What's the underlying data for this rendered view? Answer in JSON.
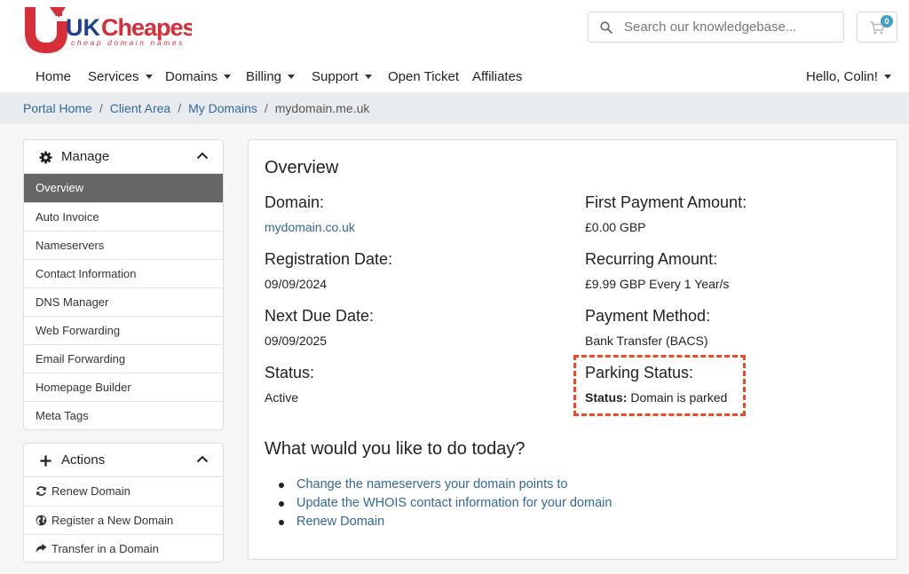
{
  "brand": {
    "name_uk": "UK",
    "name_rest": "Cheapest",
    "tagline": "cheap domain names",
    "color_blue": "#1c3f8e",
    "color_red": "#d62f3a"
  },
  "search": {
    "placeholder": "Search our knowledgebase..."
  },
  "cart": {
    "count": "0"
  },
  "nav": {
    "items": [
      {
        "label": "Home",
        "dropdown": false
      },
      {
        "label": "Services",
        "dropdown": true
      },
      {
        "label": "Domains",
        "dropdown": true
      },
      {
        "label": "Billing",
        "dropdown": true
      },
      {
        "label": "Support",
        "dropdown": true
      },
      {
        "label": "Open Ticket",
        "dropdown": false
      },
      {
        "label": "Affiliates",
        "dropdown": false
      }
    ],
    "user": "Hello, Colin!"
  },
  "breadcrumb": {
    "items": [
      "Portal Home",
      "Client Area",
      "My Domains"
    ],
    "current": "mydomain.me.uk"
  },
  "manage_panel": {
    "title": "Manage",
    "icon": "gear-icon",
    "items": [
      "Overview",
      "Auto Invoice",
      "Nameservers",
      "Contact Information",
      "DNS Manager",
      "Web Forwarding",
      "Email Forwarding",
      "Homepage Builder",
      "Meta Tags"
    ],
    "active": "Overview"
  },
  "actions_panel": {
    "title": "Actions",
    "icon": "plus-icon",
    "items": [
      {
        "label": "Renew Domain",
        "icon": "refresh-icon"
      },
      {
        "label": "Register a New Domain",
        "icon": "globe-icon"
      },
      {
        "label": "Transfer in a Domain",
        "icon": "share-arrow-icon"
      }
    ]
  },
  "overview": {
    "title": "Overview",
    "domain_label": "Domain:",
    "domain_value": "mydomain.co.uk",
    "reg_label": "Registration Date:",
    "reg_value": "09/09/2024",
    "due_label": "Next Due Date:",
    "due_value": "09/09/2025",
    "status_label": "Status:",
    "status_value": "Active",
    "first_label": "First Payment Amount:",
    "first_value": "£0.00 GBP",
    "recurring_label": "Recurring Amount:",
    "recurring_value": "£9.99 GBP Every 1 Year/s",
    "method_label": "Payment Method:",
    "method_value": "Bank Transfer (BACS)",
    "parking_label": "Parking Status:",
    "parking_key": "Status:",
    "parking_value": "Domain is parked",
    "highlight_color": "#ee4a24"
  },
  "todo": {
    "title": "What would you like to do today?",
    "links": [
      "Change the nameservers your domain points to",
      "Update the WHOIS contact information for your domain",
      "Renew Domain"
    ]
  }
}
